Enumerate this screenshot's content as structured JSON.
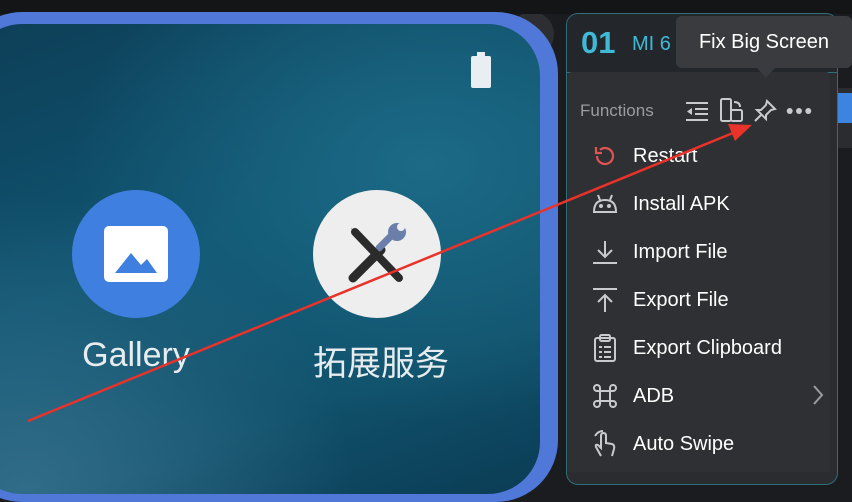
{
  "colors": {
    "frame_blue": "#4f78d8",
    "accent_teal": "#3fb9d6",
    "tooltip_bg": "#3a3b3e",
    "annotation_red": "#e8322a",
    "restart_red": "#e05454"
  },
  "phone": {
    "apps": [
      {
        "label": "Gallery",
        "icon": "gallery-icon"
      },
      {
        "label": "拓展服务",
        "icon": "tools-icon"
      }
    ]
  },
  "device": {
    "index": "01",
    "name": "MI 6"
  },
  "toolbar": {
    "functions_label": "Functions",
    "icons": [
      "outdent-icon",
      "rotate-screen-icon",
      "pin-icon",
      "more-icon"
    ]
  },
  "tooltip": {
    "text": "Fix Big Screen"
  },
  "menu": {
    "items": [
      {
        "label": "Restart",
        "icon": "restart-icon"
      },
      {
        "label": "Install APK",
        "icon": "android-icon"
      },
      {
        "label": "Import File",
        "icon": "import-icon"
      },
      {
        "label": "Export File",
        "icon": "export-icon"
      },
      {
        "label": "Export Clipboard",
        "icon": "clipboard-icon"
      },
      {
        "label": "ADB",
        "icon": "command-icon",
        "has_submenu": true
      },
      {
        "label": "Auto Swipe",
        "icon": "swipe-hand-icon"
      }
    ]
  }
}
